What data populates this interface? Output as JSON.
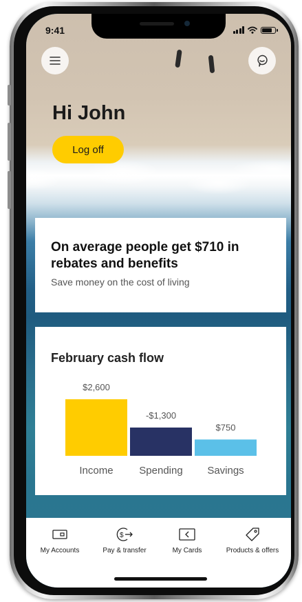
{
  "status_bar": {
    "time": "9:41",
    "battery_level": 0.85
  },
  "header": {
    "menu_icon": "hamburger-menu-icon",
    "chat_icon": "chat-bubble-icon",
    "greeting": "Hi John",
    "logoff_label": "Log off"
  },
  "promo": {
    "title": "On average people get $710 in rebates and benefits",
    "subtitle": "Save money on the cost of living"
  },
  "cash_flow": {
    "title": "February cash flow"
  },
  "chart_data": {
    "type": "bar",
    "title": "February cash flow",
    "categories": [
      "Income",
      "Spending",
      "Savings"
    ],
    "values": [
      2600,
      -1300,
      750
    ],
    "value_labels": [
      "$2,600",
      "-$1,300",
      "$750"
    ],
    "colors": [
      "#ffcc00",
      "#283264",
      "#5bc0e8"
    ],
    "grid": false,
    "legend": "none"
  },
  "bottom_nav": {
    "items": [
      {
        "label": "My Accounts",
        "icon": "wallet-icon"
      },
      {
        "label": "Pay & transfer",
        "icon": "pay-transfer-icon"
      },
      {
        "label": "My Cards",
        "icon": "card-icon"
      },
      {
        "label": "Products & offers",
        "icon": "tag-icon"
      }
    ]
  }
}
